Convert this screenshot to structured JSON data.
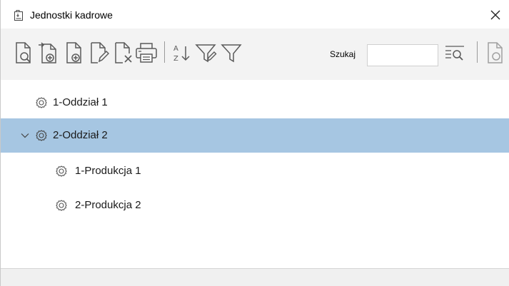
{
  "window": {
    "title": "Jednostki kadrowe",
    "close_glyph": "✕"
  },
  "toolbar": {
    "buttons": [
      {
        "icon": "document-preview-icon"
      },
      {
        "icon": "document-add-from-icon"
      },
      {
        "icon": "document-add-icon"
      },
      {
        "icon": "document-edit-icon"
      },
      {
        "icon": "document-delete-icon"
      },
      {
        "icon": "printer-icon"
      },
      {
        "icon": "sort-az-icon"
      },
      {
        "icon": "filter-edit-icon"
      },
      {
        "icon": "filter-icon"
      }
    ],
    "search_label": "Szukaj",
    "search_value": "",
    "search_button_icon": "search-list-icon",
    "trailing_icon": "document-icon"
  },
  "tree": {
    "items": [
      {
        "label": "1-Oddział 1",
        "level": 0,
        "expanded": null,
        "selected": false
      },
      {
        "label": "2-Oddział 2",
        "level": 0,
        "expanded": true,
        "selected": true
      },
      {
        "label": "1-Produkcja 1",
        "level": 1,
        "expanded": null,
        "selected": false
      },
      {
        "label": "2-Produkcja 2",
        "level": 1,
        "expanded": null,
        "selected": false
      }
    ]
  },
  "colors": {
    "selection": "#a6c6e2",
    "toolbar_bg": "#f3f3f3",
    "icon_stroke": "#5a5a5a"
  }
}
